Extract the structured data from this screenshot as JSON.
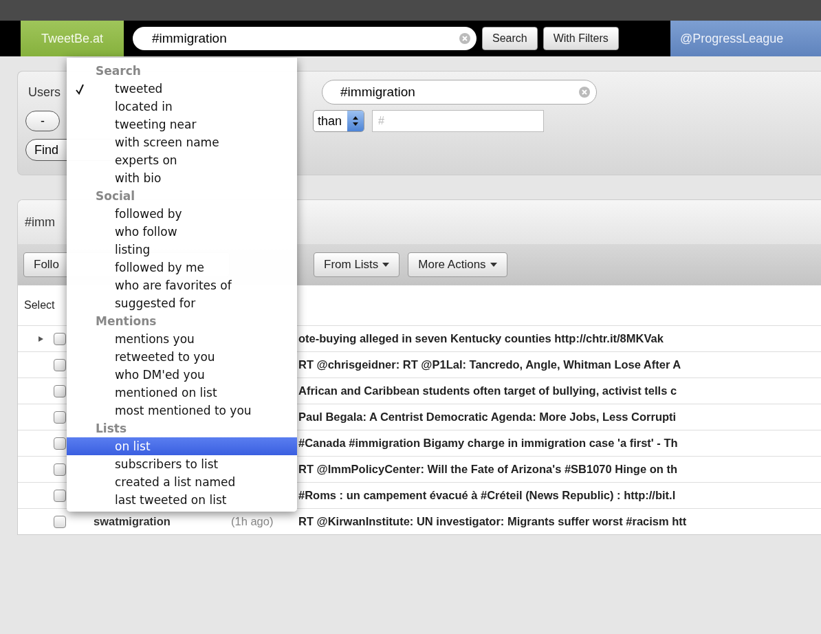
{
  "top_bar": {
    "logo": "TweetBe.at",
    "search": {
      "value": "#immigration"
    },
    "buttons": [
      "Search",
      "With Filters"
    ],
    "account": "@ProgressLeague"
  },
  "filter_panel": {
    "label": "Users",
    "remove_button": "-",
    "term_field": {
      "value": "#immigration"
    },
    "comparison_select": "than",
    "count_field": {
      "placeholder": "#"
    },
    "find_button": "Find"
  },
  "results": {
    "heading": "#imm",
    "actions": [
      {
        "label": "Follo",
        "dropdown": false
      },
      {
        "label": "From Lists",
        "dropdown": true
      },
      {
        "label": "More Actions",
        "dropdown": true
      }
    ],
    "select_label": "Select",
    "rows": [
      {
        "expandable": true,
        "checked": false,
        "screen_name": "",
        "time": "",
        "tweet": "ote-buying alleged in seven Kentucky counties http://chtr.it/8MKVak"
      },
      {
        "expandable": false,
        "checked": false,
        "screen_name": "",
        "time": "",
        "tweet": "RT @chrisgeidner: RT @P1Lal: Tancredo, Angle, Whitman Lose After A"
      },
      {
        "expandable": false,
        "checked": false,
        "screen_name": "",
        "time": "",
        "tweet": "African and Caribbean students often target of bullying, activist tells c"
      },
      {
        "expandable": false,
        "checked": false,
        "screen_name": "",
        "time": "",
        "tweet": "Paul Begala: A Centrist Democratic Agenda: More Jobs, Less Corrupti"
      },
      {
        "expandable": false,
        "checked": false,
        "screen_name": "",
        "time": "",
        "tweet": "#Canada #immigration Bigamy charge in immigration case 'a first' - Th"
      },
      {
        "expandable": false,
        "checked": false,
        "screen_name": "",
        "time": "",
        "tweet": "RT @ImmPolicyCenter: Will the Fate of Arizona's #SB1070 Hinge on th"
      },
      {
        "expandable": false,
        "checked": false,
        "screen_name": "",
        "time": "",
        "tweet": "#Roms : un campement évacué à #Créteil (News Republic) : http://bit.l"
      },
      {
        "expandable": false,
        "checked": false,
        "screen_name": "swatmigration",
        "time": "(1h ago)",
        "tweet": "RT @KirwanInstitute: UN investigator: Migrants suffer worst #racism htt"
      }
    ]
  },
  "menu": {
    "sections": [
      {
        "title": "Search",
        "items": [
          {
            "label": "tweeted",
            "checked": true,
            "selected": false
          },
          {
            "label": "located in",
            "checked": false,
            "selected": false
          },
          {
            "label": "tweeting near",
            "checked": false,
            "selected": false
          },
          {
            "label": "with screen name",
            "checked": false,
            "selected": false
          },
          {
            "label": "experts on",
            "checked": false,
            "selected": false
          },
          {
            "label": "with bio",
            "checked": false,
            "selected": false
          }
        ]
      },
      {
        "title": "Social",
        "items": [
          {
            "label": "followed by",
            "checked": false,
            "selected": false
          },
          {
            "label": "who follow",
            "checked": false,
            "selected": false
          },
          {
            "label": "listing",
            "checked": false,
            "selected": false
          },
          {
            "label": "followed by me",
            "checked": false,
            "selected": false
          },
          {
            "label": "who are favorites of",
            "checked": false,
            "selected": false
          },
          {
            "label": "suggested for",
            "checked": false,
            "selected": false
          }
        ]
      },
      {
        "title": "Mentions",
        "items": [
          {
            "label": "mentions you",
            "checked": false,
            "selected": false
          },
          {
            "label": "retweeted to you",
            "checked": false,
            "selected": false
          },
          {
            "label": "who DM'ed you",
            "checked": false,
            "selected": false
          },
          {
            "label": "mentioned on list",
            "checked": false,
            "selected": false
          },
          {
            "label": "most mentioned to you",
            "checked": false,
            "selected": false
          }
        ]
      },
      {
        "title": "Lists",
        "items": [
          {
            "label": "on list",
            "checked": false,
            "selected": true
          },
          {
            "label": "subscribers to list",
            "checked": false,
            "selected": false
          },
          {
            "label": "created a list named",
            "checked": false,
            "selected": false
          },
          {
            "label": "last tweeted on list",
            "checked": false,
            "selected": false
          }
        ]
      }
    ]
  }
}
